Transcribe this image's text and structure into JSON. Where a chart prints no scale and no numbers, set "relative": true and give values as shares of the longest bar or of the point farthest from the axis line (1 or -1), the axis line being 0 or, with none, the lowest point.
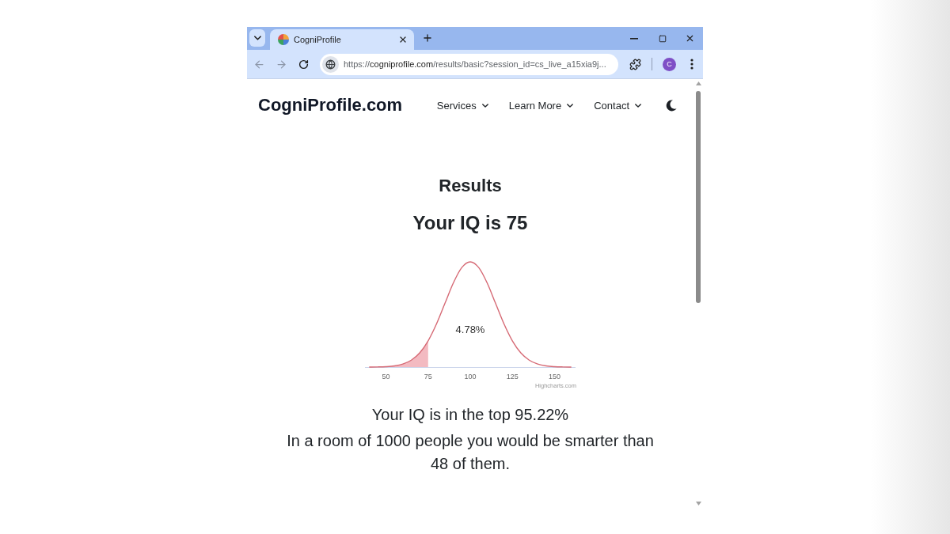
{
  "browser": {
    "tabs": [
      {
        "title": "CogniProfile",
        "selected": true
      }
    ],
    "navigation": {
      "back_enabled": false,
      "forward_enabled": false
    },
    "address_bar": {
      "scheme": "https://",
      "host": "cogniprofile.com",
      "path": "/results/basic?session_id=cs_live_a15xia9j..."
    },
    "profile_initial": "C"
  },
  "site": {
    "logo": "CogniProfile.com",
    "nav": [
      {
        "label": "Services",
        "has_menu": true
      },
      {
        "label": "Learn More",
        "has_menu": true
      },
      {
        "label": "Contact",
        "has_menu": true
      }
    ]
  },
  "results": {
    "heading": "Results",
    "score_line": "Your IQ is 75",
    "chart": {
      "chart_data": {
        "type": "line",
        "relative": true,
        "x": [
          40,
          45,
          50,
          55,
          60,
          65,
          70,
          75,
          80,
          85,
          90,
          95,
          100,
          105,
          110,
          115,
          120,
          125,
          130,
          135,
          140,
          145,
          150,
          155,
          160
        ],
        "series": [
          {
            "type": "line",
            "color": "#d66a75",
            "values": [
              0.0003,
              0.0012,
              0.0039,
              0.0111,
              0.0286,
              0.0657,
              0.1353,
              0.2494,
              0.4111,
              0.6065,
              0.8007,
              0.946,
              1,
              0.946,
              0.8007,
              0.6065,
              0.4111,
              0.2494,
              0.1353,
              0.0657,
              0.0286,
              0.0111,
              0.0039,
              0.0012,
              0.0003
            ]
          },
          {
            "type": "area",
            "color": "#f3bac1",
            "values": [
              0.0003,
              0.0012,
              0.0039,
              0.0111,
              0.0286,
              0.0657,
              0.1353,
              0.2494,
              null,
              null,
              null,
              null,
              null,
              null,
              null,
              null,
              null,
              null,
              null,
              null,
              null,
              null,
              null,
              null,
              null
            ]
          }
        ],
        "xlim": [
          37.5,
          162.5
        ],
        "xticks": [
          50,
          75,
          100,
          125,
          150
        ],
        "annotations": [
          "4.78%"
        ]
      },
      "credit": "Highcharts.com"
    },
    "rank_line": "Your IQ is in the top 95.22%",
    "comparison": "In a room of 1000 people you would be smarter than 48 of them."
  }
}
